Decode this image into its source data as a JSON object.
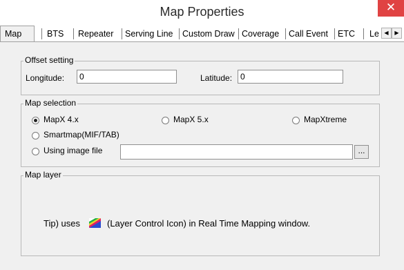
{
  "window": {
    "title": "Map Properties",
    "close_glyph": "✕"
  },
  "tabs": [
    "Map",
    "BTS",
    "Repeater",
    "Serving Line",
    "Custom Draw",
    "Coverage",
    "Call Event",
    "ETC",
    "Le"
  ],
  "tab_scroll": {
    "left": "◀",
    "right": "▶"
  },
  "offset": {
    "legend": "Offset setting",
    "longitude_label": "Longitude:",
    "longitude_value": "0",
    "latitude_label": "Latitude:",
    "latitude_value": "0"
  },
  "map_selection": {
    "legend": "Map selection",
    "mapx4": "MapX 4.x",
    "mapx5": "MapX 5.x",
    "mapxtreme": "MapXtreme",
    "smartmap": "Smartmap(MIF/TAB)",
    "image_file": "Using image file",
    "image_path": "",
    "browse": "...",
    "selected": "MapX 4.x"
  },
  "map_layer": {
    "legend": "Map layer",
    "tip_prefix": "Tip) uses",
    "tip_suffix": "(Layer Control Icon) in Real Time Mapping window.",
    "icon": "layer-control-icon"
  }
}
